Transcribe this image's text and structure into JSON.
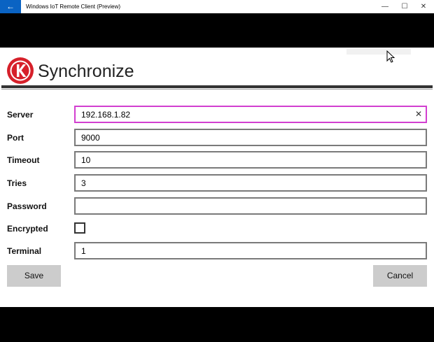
{
  "window": {
    "title": "Windows IoT Remote Client (Preview)",
    "back_glyph": "←",
    "minimize_glyph": "—",
    "maximize_glyph": "☐",
    "close_glyph": "✕"
  },
  "header": {
    "title": "Synchronize",
    "logo_letter": "K"
  },
  "form": {
    "server": {
      "label": "Server",
      "value": "192.168.1.82"
    },
    "port": {
      "label": "Port",
      "value": "9000"
    },
    "timeout": {
      "label": "Timeout",
      "value": "10"
    },
    "tries": {
      "label": "Tries",
      "value": "3"
    },
    "password": {
      "label": "Password",
      "value": ""
    },
    "encrypted": {
      "label": "Encrypted",
      "checked": false
    },
    "terminal": {
      "label": "Terminal",
      "value": "1"
    },
    "clear_glyph": "✕"
  },
  "buttons": {
    "save": "Save",
    "cancel": "Cancel"
  },
  "colors": {
    "accent": "#0a63c3",
    "focus_border": "#d23fd0",
    "logo_red": "#d6202a"
  }
}
